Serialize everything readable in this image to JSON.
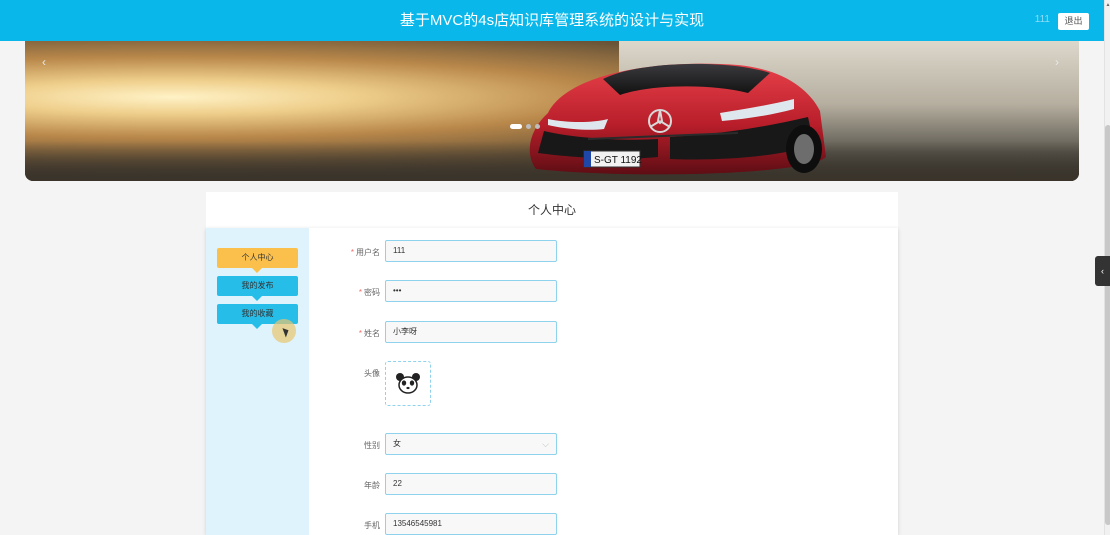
{
  "header": {
    "title": "基于MVC的4s店知识库管理系统的设计与实现",
    "username": "111",
    "logout_label": "退出",
    "bg_color": "#09b7ea"
  },
  "banner": {
    "plate": "S-GT 1192",
    "prev_icon": "‹",
    "next_icon": "›",
    "slide_count": 3,
    "active_slide": 1
  },
  "side_tab": {
    "icon": "‹"
  },
  "panel": {
    "title": "个人中心"
  },
  "menu": {
    "items": [
      {
        "label": "个人中心",
        "active": true
      },
      {
        "label": "我的发布",
        "active": false
      },
      {
        "label": "我的收藏",
        "active": false
      }
    ],
    "active_color": "#fbc04c",
    "color": "#27bde9"
  },
  "form": {
    "username_label": "用户名",
    "username_value": "111",
    "password_label": "密码",
    "password_value": "•••",
    "name_label": "姓名",
    "name_value": "小李呀",
    "avatar_label": "头像",
    "gender_label": "性别",
    "gender_value": "女",
    "age_label": "年龄",
    "age_value": "22",
    "phone_label": "手机",
    "phone_value": "13546545981"
  }
}
